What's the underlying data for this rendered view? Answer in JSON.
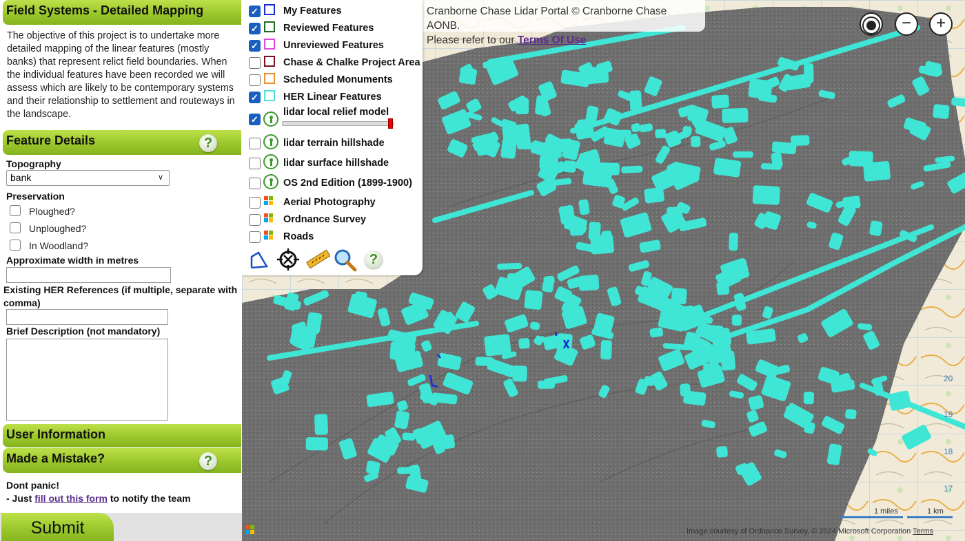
{
  "sidebar": {
    "title": "Field Systems - Detailed Mapping",
    "intro": "The objective of this project is to undertake more detailed mapping of the linear features (mostly banks) that represent relict field boundaries. When the individual features have been recorded we will assess which are likely to be contemporary systems and their relationship to settlement and routeways in the landscape.",
    "feature_details": {
      "heading": "Feature Details",
      "help": "?",
      "topography_label": "Topography",
      "topography_value": "bank",
      "preservation_label": "Preservation",
      "options": [
        "Ploughed?",
        "Unploughed?",
        "In Woodland?"
      ],
      "width_label": "Approximate width in metres",
      "her_label": "Existing HER References (if multiple, separate with comma)",
      "desc_label": "Brief Description (not mandatory)"
    },
    "user_info": {
      "heading": "User Information"
    },
    "mistake": {
      "heading": "Made a Mistake?",
      "help": "?",
      "line1": "Dont panic!",
      "line2_prefix": "- Just ",
      "link": "fill out this form",
      "line2_suffix": " to notify the team"
    },
    "submit": "Submit"
  },
  "layers": {
    "items": [
      {
        "label": "My Features",
        "checked": true,
        "swatch": "#1c2bd6"
      },
      {
        "label": "Reviewed Features",
        "checked": true,
        "swatch": "#1f6b1f"
      },
      {
        "label": "Unreviewed Features",
        "checked": true,
        "swatch": "#e04ad8"
      },
      {
        "label": "Chase & Chalke Project Area",
        "checked": false,
        "swatch": "#7a1020"
      },
      {
        "label": "Scheduled Monuments",
        "checked": false,
        "swatch": "#f0902a"
      },
      {
        "label": "HER Linear Features",
        "checked": true,
        "swatch": "#4fe0d8"
      },
      {
        "label": "lidar local relief model",
        "checked": true,
        "icon": "keyhole-icon"
      },
      {
        "label": "lidar terrain hillshade",
        "checked": false,
        "icon": "keyhole-icon"
      },
      {
        "label": "lidar surface hillshade",
        "checked": false,
        "icon": "keyhole-icon"
      },
      {
        "label": "OS 2nd Edition (1899-1900)",
        "checked": false,
        "icon": "keyhole-icon"
      },
      {
        "label": "Aerial Photography",
        "checked": false,
        "icon": "microsoft-icon"
      },
      {
        "label": "Ordnance Survey",
        "checked": false,
        "icon": "microsoft-icon"
      },
      {
        "label": "Roads",
        "checked": false,
        "icon": "microsoft-icon"
      }
    ],
    "opacity": 1.0,
    "tools": [
      "draw-line-icon",
      "locate-crosshair-icon",
      "measure-ruler-icon",
      "magnifier-icon",
      "help-icon"
    ],
    "tool_help": "?"
  },
  "map": {
    "attribution_line1": "Cranborne Chase Lidar Portal © Cranborne Chase AONB.",
    "attribution_prefix": "Please refer to our ",
    "attribution_link": "Terms Of Use",
    "zoom_out": "−",
    "zoom_in": "+",
    "scale_miles": "1 miles",
    "scale_km": "1 km",
    "copyright": "Image courtesy of Ordnance Survey, © 2024 Microsoft Corporation",
    "terms": "Terms",
    "grid_numbers": [
      "20",
      "19",
      "18",
      "17"
    ],
    "colors": {
      "features": "#3fe6d6",
      "lidar": "#707070",
      "mine": "#1c2bd6"
    }
  }
}
